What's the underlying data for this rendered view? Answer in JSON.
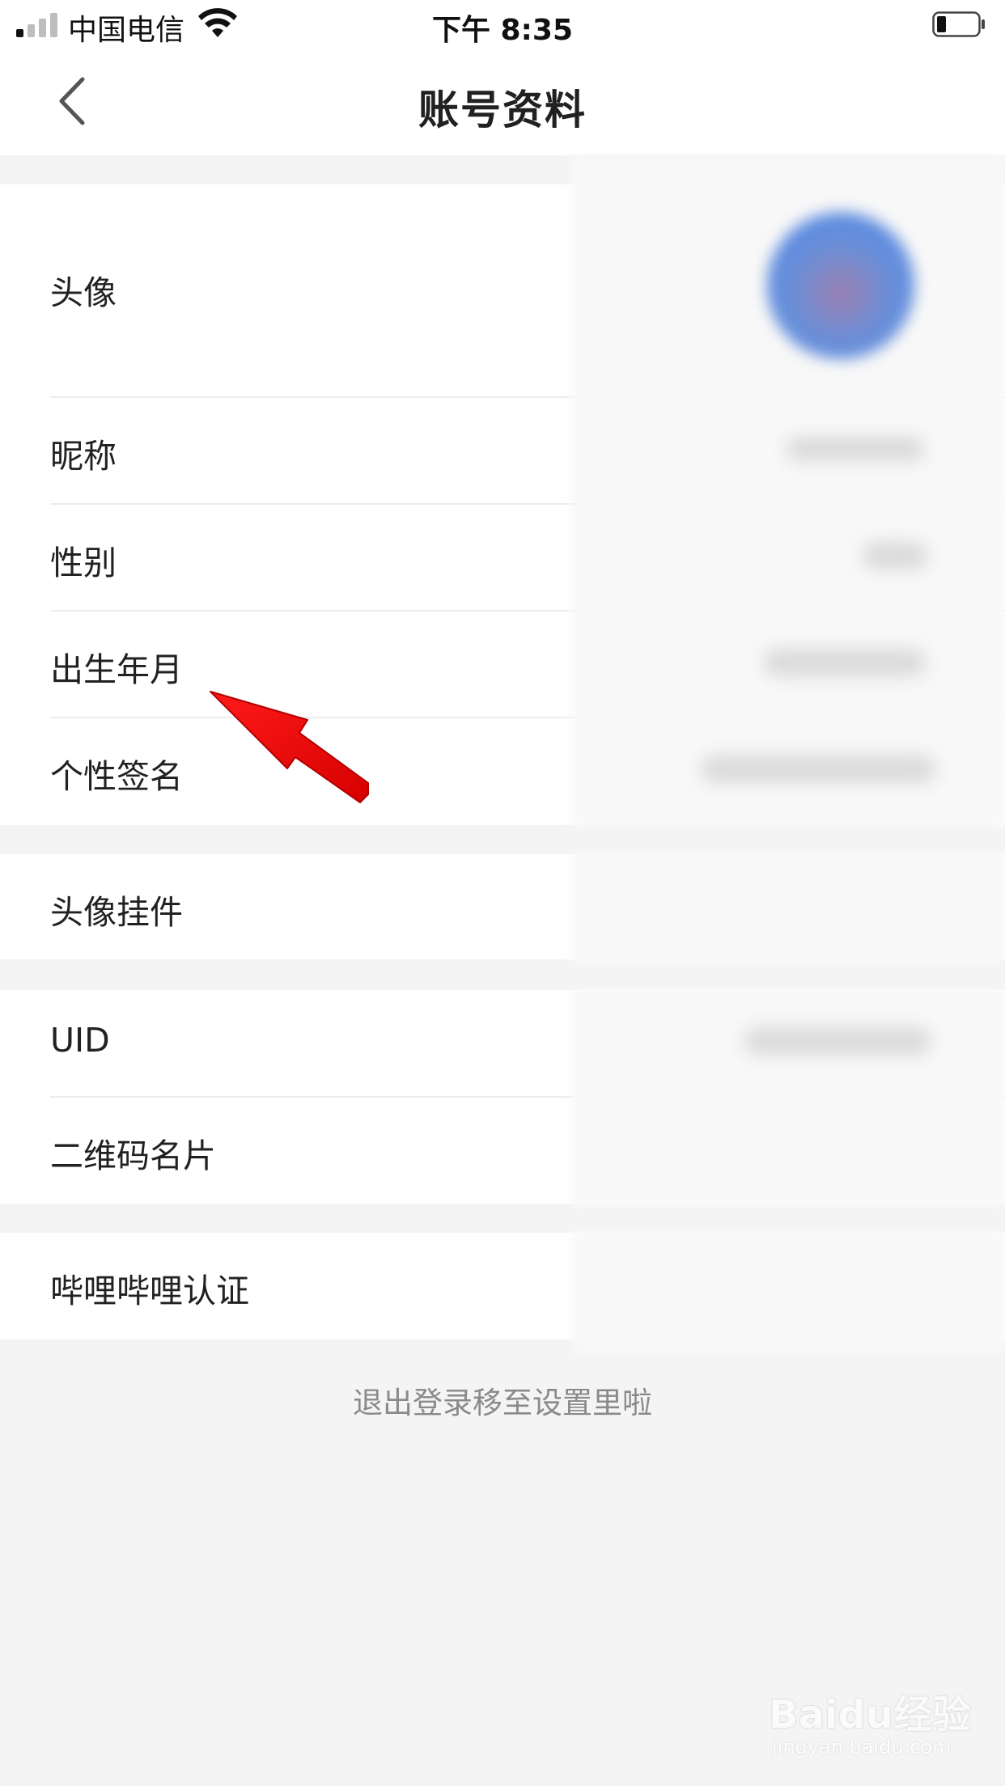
{
  "status_bar": {
    "carrier": "中国电信",
    "time": "下午 8:35",
    "signal_bars_on": 1,
    "signal_bars_total": 4,
    "battery_level": 0.2
  },
  "header": {
    "title": "账号资料",
    "back_icon": "chevron-left-icon"
  },
  "profile_group": [
    {
      "key": "avatar",
      "label": "头像"
    },
    {
      "key": "nickname",
      "label": "昵称"
    },
    {
      "key": "gender",
      "label": "性别"
    },
    {
      "key": "birth",
      "label": "出生年月"
    },
    {
      "key": "signature",
      "label": "个性签名"
    }
  ],
  "pendant_group": [
    {
      "key": "avatar_pendant",
      "label": "头像挂件"
    }
  ],
  "id_group": [
    {
      "key": "uid",
      "label": "UID"
    },
    {
      "key": "qr_card",
      "label": "二维码名片"
    }
  ],
  "verify_group": [
    {
      "key": "verification",
      "label": "哔哩哔哩认证"
    }
  ],
  "footer": {
    "logout_hint": "退出登录移至设置里啦"
  },
  "annotation": {
    "arrow_color": "#ff0000",
    "arrow_icon": "red-arrow-pointer"
  },
  "watermark": {
    "brand": "Baidu经验",
    "url": "jingyan.baidu.com"
  }
}
